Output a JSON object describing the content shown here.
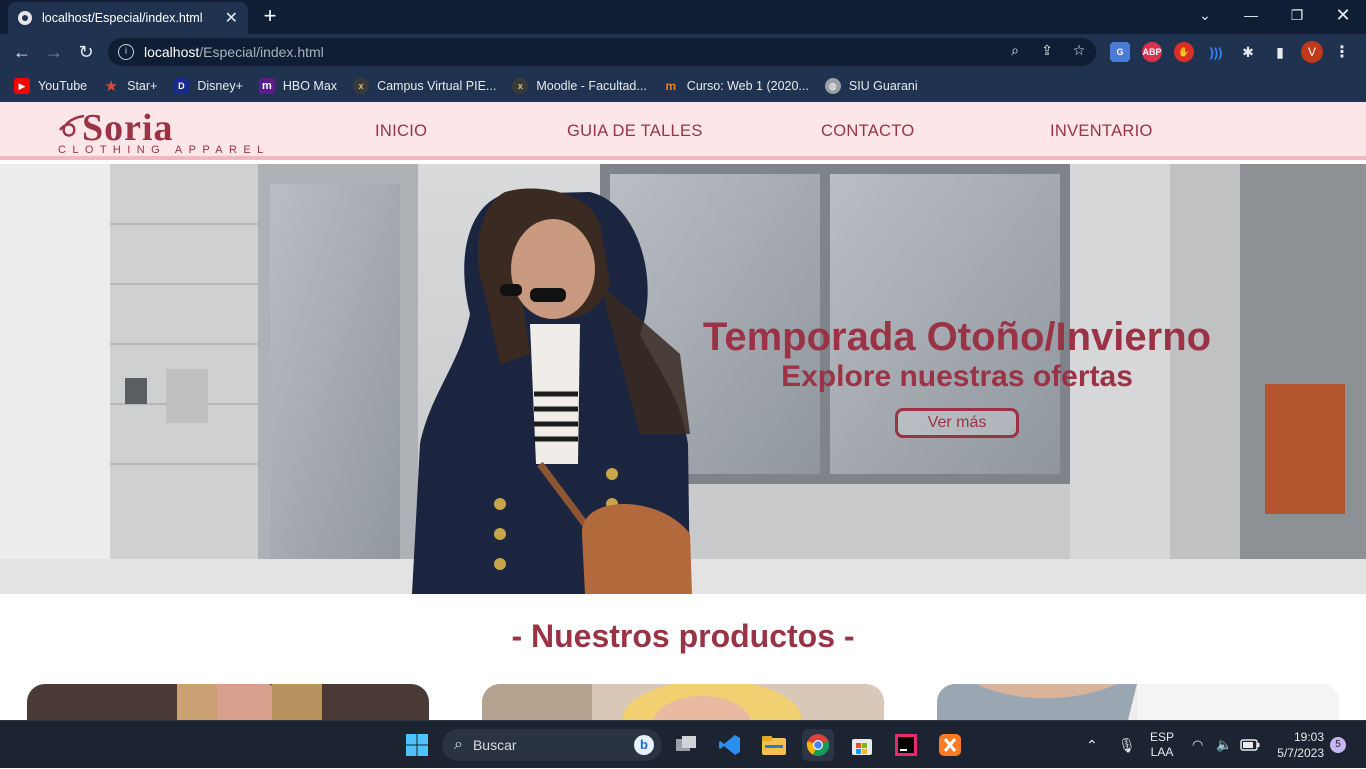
{
  "browser": {
    "tab_title": "localhost/Especial/index.html",
    "url_host": "localhost",
    "url_path": "/Especial/index.html",
    "avatar_letter": "V"
  },
  "bookmarks": [
    {
      "label": "YouTube",
      "icon": "youtube-icon",
      "color": "#ff0000"
    },
    {
      "label": "Star+",
      "icon": "star-icon",
      "color": "#e8453c"
    },
    {
      "label": "Disney+",
      "icon": "disney-icon",
      "color": "#1a2a8c"
    },
    {
      "label": "HBO Max",
      "icon": "hbo-icon",
      "color": "#5b1c8c"
    },
    {
      "label": "Campus Virtual PIE...",
      "icon": "campus-icon",
      "color": "#3a3a3a"
    },
    {
      "label": "Moodle - Facultad...",
      "icon": "moodle-icon",
      "color": "#3a3a3a"
    },
    {
      "label": "Curso: Web 1 (2020...",
      "icon": "moodle-orange-icon",
      "color": "#f98012"
    },
    {
      "label": "SIU Guarani",
      "icon": "globe-icon",
      "color": "#9aa0a6"
    }
  ],
  "site": {
    "logo_word": "Soria",
    "logo_sub": "CLOTHING APPAREL",
    "nav": [
      "INICIO",
      "GUIA DE TALLES",
      "CONTACTO",
      "INVENTARIO"
    ],
    "hero_title": "Temporada Otoño/Invierno",
    "hero_subtitle": "Explore nuestras ofertas",
    "hero_button": "Ver más",
    "products_title": "- Nuestros productos -",
    "accent_color": "#9a3346",
    "header_bg": "#fce6e8"
  },
  "taskbar": {
    "search_placeholder": "Buscar",
    "lang_line1": "ESP",
    "lang_line2": "LAA",
    "time": "19:03",
    "date": "5/7/2023",
    "notifications": "5"
  }
}
